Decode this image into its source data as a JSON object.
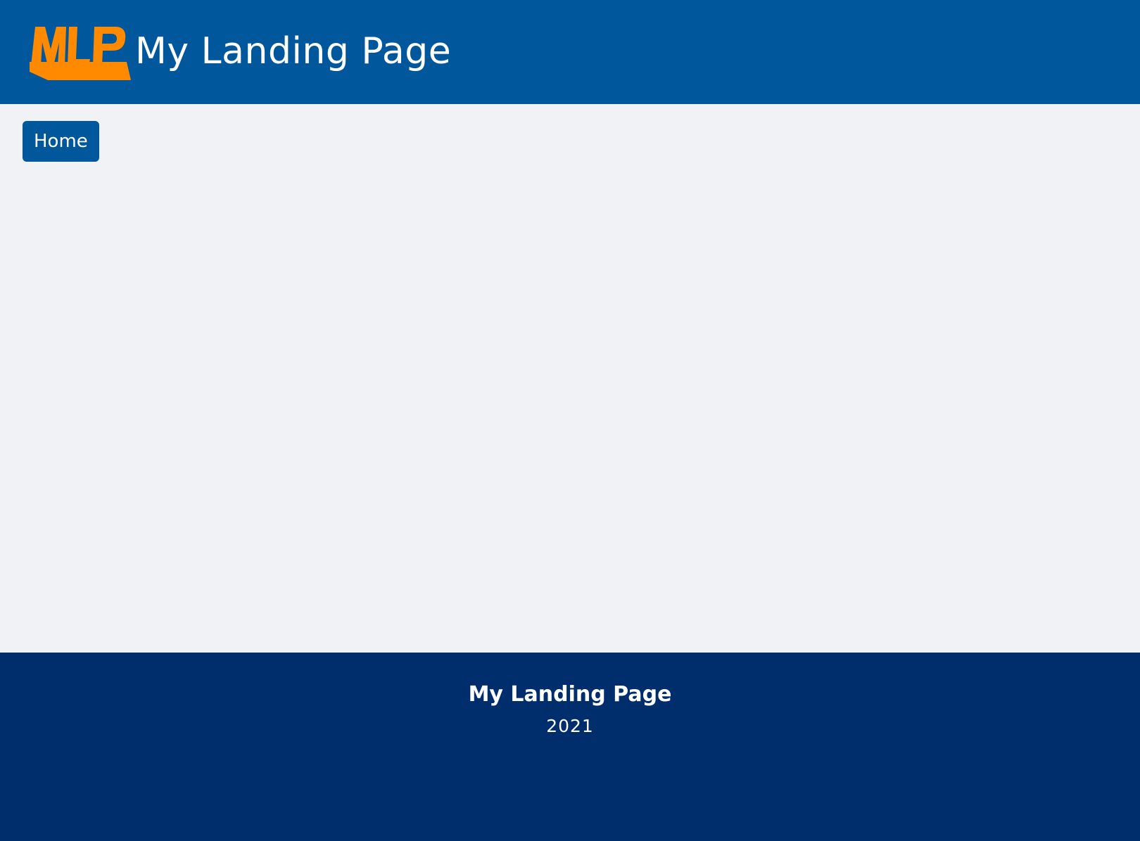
{
  "header": {
    "logo_text": "MLP",
    "title": "My Landing Page"
  },
  "nav": {
    "home_label": "Home"
  },
  "footer": {
    "title": "My Landing Page",
    "year": "2021"
  },
  "colors": {
    "header_bg": "#00579c",
    "logo_orange": "#ff8a00",
    "page_bg": "#f1f2f6",
    "button_bg": "#00579c",
    "footer_bg": "#002e6d"
  }
}
